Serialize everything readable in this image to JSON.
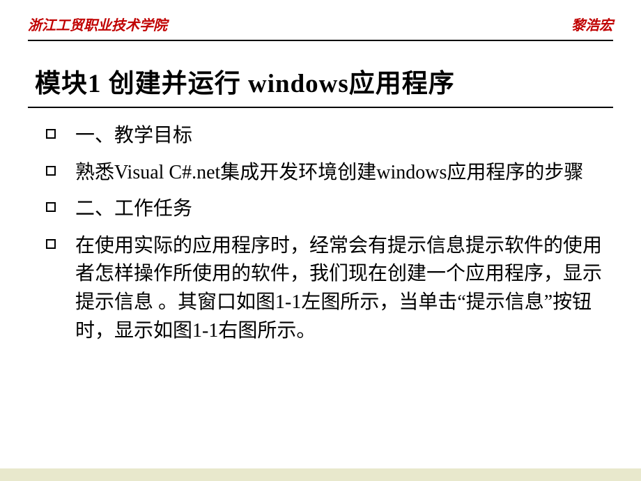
{
  "header": {
    "left": "浙江工贸职业技术学院",
    "right": "黎浩宏"
  },
  "title": "模块1  创建并运行 windows应用程序",
  "items": [
    "一、教学目标",
    "熟悉Visual C#.net集成开发环境创建windows应用程序的步骤",
    "二、工作任务",
    "在使用实际的应用程序时，经常会有提示信息提示软件的使用者怎样操作所使用的软件，我们现在创建一个应用程序，显示提示信息 。其窗口如图1-1左图所示，当单击“提示信息”按钮时，显示如图1-1右图所示。"
  ]
}
